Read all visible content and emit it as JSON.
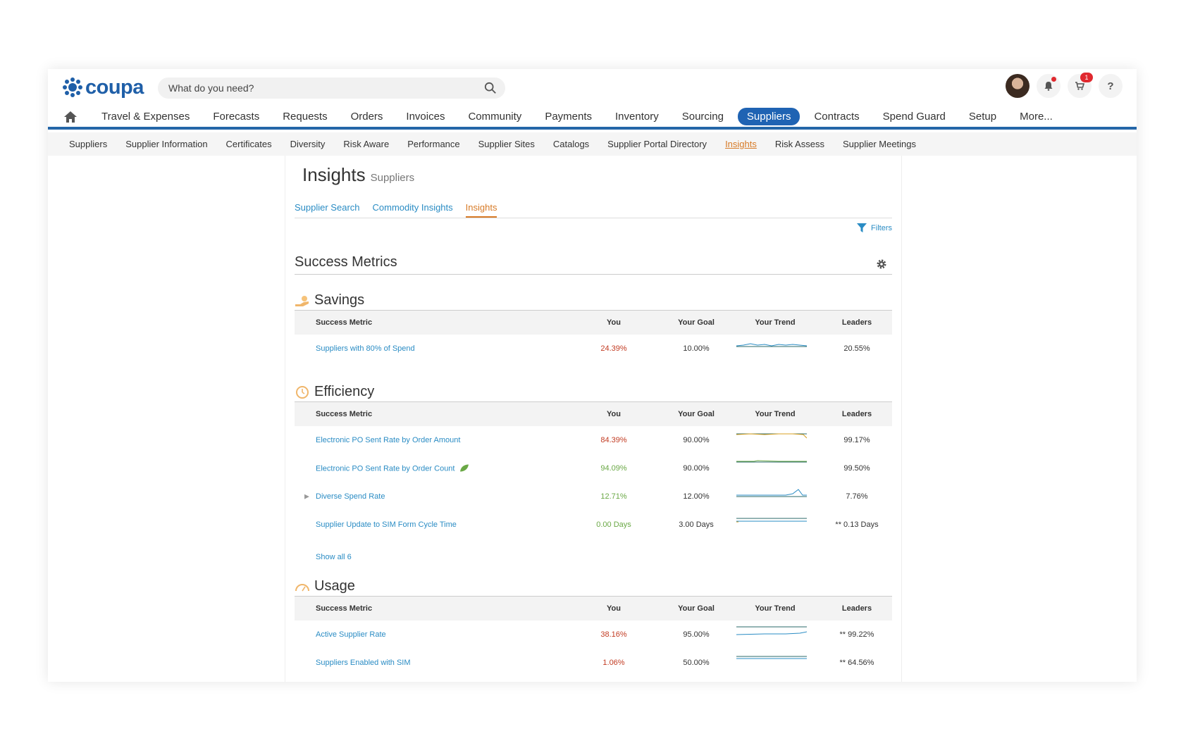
{
  "brand": {
    "name": "coupa",
    "color": "#1f5fa8"
  },
  "search": {
    "placeholder": "What do you need?"
  },
  "header": {
    "cart_count": "1"
  },
  "main_nav": [
    {
      "label": "Travel & Expenses"
    },
    {
      "label": "Forecasts"
    },
    {
      "label": "Requests"
    },
    {
      "label": "Orders"
    },
    {
      "label": "Invoices"
    },
    {
      "label": "Community"
    },
    {
      "label": "Payments"
    },
    {
      "label": "Inventory"
    },
    {
      "label": "Sourcing"
    },
    {
      "label": "Suppliers",
      "active": true
    },
    {
      "label": "Contracts"
    },
    {
      "label": "Spend Guard"
    },
    {
      "label": "Setup"
    },
    {
      "label": "More..."
    }
  ],
  "sub_nav": [
    {
      "label": "Suppliers"
    },
    {
      "label": "Supplier Information"
    },
    {
      "label": "Certificates"
    },
    {
      "label": "Diversity"
    },
    {
      "label": "Risk Aware"
    },
    {
      "label": "Performance"
    },
    {
      "label": "Supplier Sites"
    },
    {
      "label": "Catalogs"
    },
    {
      "label": "Supplier Portal Directory"
    },
    {
      "label": "Insights",
      "active": true
    },
    {
      "label": "Risk Assess"
    },
    {
      "label": "Supplier Meetings"
    }
  ],
  "page": {
    "title": "Insights",
    "subtitle": "Suppliers"
  },
  "tabs": [
    {
      "label": "Supplier Search"
    },
    {
      "label": "Commodity Insights"
    },
    {
      "label": "Insights",
      "active": true
    }
  ],
  "filters_label": "Filters",
  "section_title": "Success Metrics",
  "columns": {
    "metric": "Success Metric",
    "you": "You",
    "goal": "Your Goal",
    "trend": "Your Trend",
    "leaders": "Leaders"
  },
  "categories": {
    "savings": {
      "title": "Savings",
      "rows": [
        {
          "metric": "Suppliers with 80% of Spend",
          "you": "24.39%",
          "you_status": "red",
          "goal": "10.00%",
          "leaders": "20.55%"
        }
      ]
    },
    "efficiency": {
      "title": "Efficiency",
      "rows": [
        {
          "metric": "Electronic PO Sent Rate by Order Amount",
          "you": "84.39%",
          "you_status": "red",
          "goal": "90.00%",
          "leaders": "99.17%"
        },
        {
          "metric": "Electronic PO Sent Rate by Order Count",
          "you": "94.09%",
          "you_status": "green",
          "goal": "90.00%",
          "leaders": "99.50%"
        },
        {
          "metric": "Diverse Spend Rate",
          "you": "12.71%",
          "you_status": "green",
          "goal": "12.00%",
          "leaders": "7.76%"
        },
        {
          "metric": "Supplier Update to SIM Form Cycle Time",
          "you": "0.00 Days",
          "you_status": "green",
          "goal": "3.00 Days",
          "leaders": "** 0.13 Days"
        }
      ],
      "show_all": "Show all 6"
    },
    "usage": {
      "title": "Usage",
      "rows": [
        {
          "metric": "Active Supplier Rate",
          "you": "38.16%",
          "you_status": "red",
          "goal": "95.00%",
          "leaders": "** 99.22%"
        },
        {
          "metric": "Suppliers Enabled with SIM",
          "you": "1.06%",
          "you_status": "red",
          "goal": "50.00%",
          "leaders": "** 64.56%"
        }
      ]
    }
  },
  "colors": {
    "link": "#2a8cc4",
    "active_tab": "#d77a26",
    "red_value": "#c23b22",
    "green_value": "#6aa845",
    "nav_active": "#1f63b3"
  }
}
